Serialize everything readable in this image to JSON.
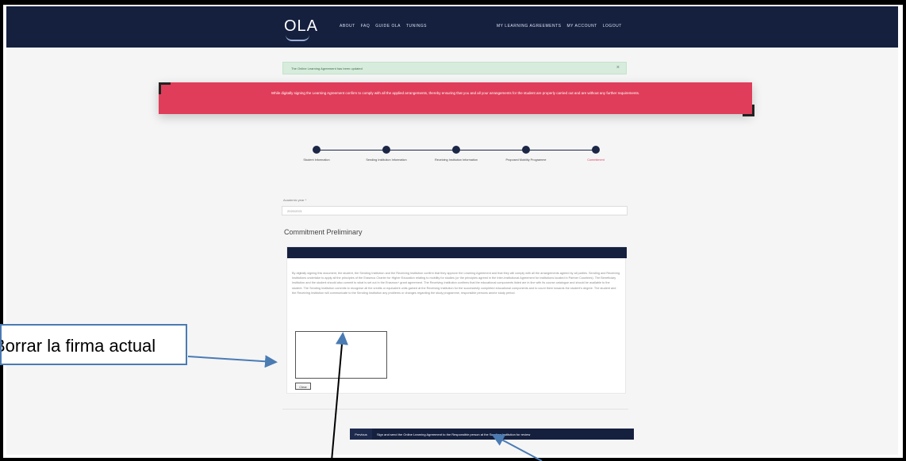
{
  "nav": {
    "logo": "OLA",
    "links_left": [
      "ABOUT",
      "FAQ",
      "GUIDE OLA",
      "TUNINGS"
    ],
    "links_right": [
      "MY LEARNING AGREEMENTS",
      "MY ACCOUNT",
      "LOGOUT"
    ]
  },
  "alerts": {
    "success": "The Online Learning Agreement has been updated",
    "close": "×",
    "warning": "While digitally signing the Learning Agreement confirm to comply with all the applied arrangements, thereby ensuring that you and all your arrangements for the student are properly carried out and are without any further requirements."
  },
  "steps": [
    {
      "label": "Student Information",
      "active": false
    },
    {
      "label": "Sending Institution Information",
      "active": false
    },
    {
      "label": "Receiving Institution Information",
      "active": false
    },
    {
      "label": "Proposed Mobility Programme",
      "active": false
    },
    {
      "label": "Commitment",
      "active": true
    }
  ],
  "form": {
    "field_label": "Academic year *",
    "field_value": "2020/2021",
    "section_title": "Commitment Preliminary",
    "commitment_text": "By digitally signing this document, the student, the Sending Institution and the Receiving Institution confirm that they approve the Learning Agreement and that they will comply with all the arrangements agreed by all parties. Sending and Receiving Institutions undertake to apply all the principles of the Erasmus Charter for Higher Education relating to mobility for studies (or the principles agreed in the Inter-Institutional Agreement for institutions located in Partner Countries). The Beneficiary Institution and the student should also commit to what is set out in the Erasmus+ grant agreement. The Receiving Institution confirms that the educational components listed are in line with its course catalogue and should be available to the student. The Sending Institution commits to recognise all the credits or equivalent units gained at the Receiving Institution for the successfully completed educational components and to count them towards the student's degree. The student and the Receiving Institution will communicate to the Sending Institution any problems or changes regarding the study programme, responsible persons and/or study period.",
    "clear_label": "Clear",
    "previous_label": "Previous",
    "submit_label": "Sign and send the Online Learning Agreement to the Responsible person at the Sending Institution for review"
  },
  "annotation": {
    "callout_text": "Borrar la firma actual"
  }
}
